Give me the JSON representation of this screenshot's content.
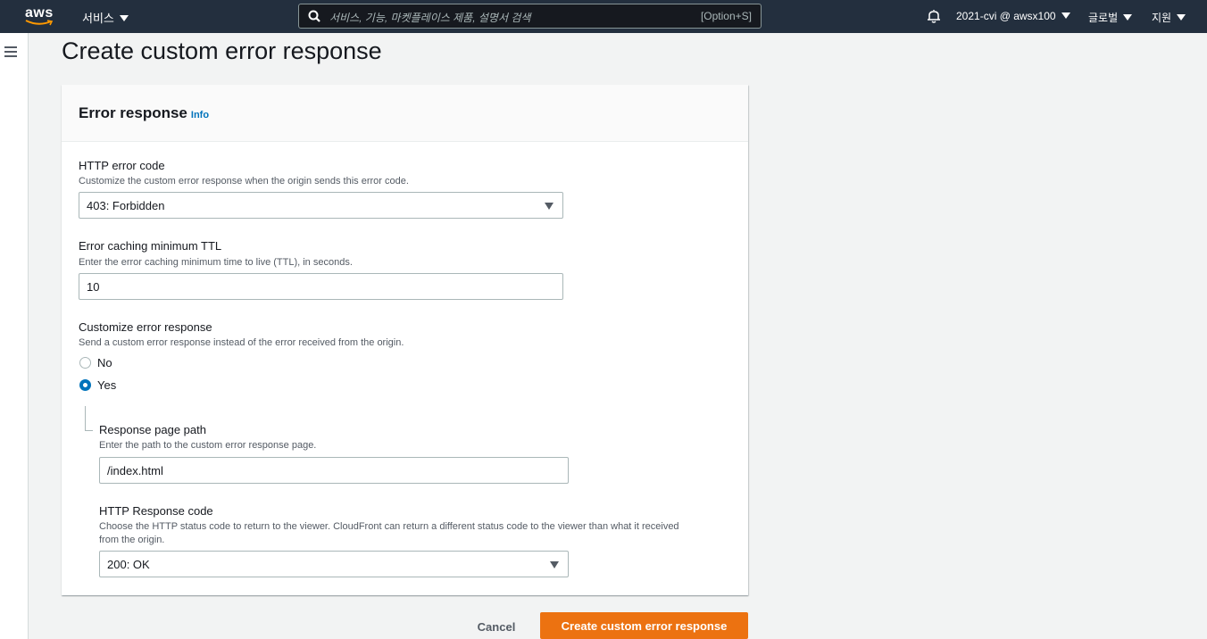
{
  "topnav": {
    "logo_text": "aws",
    "services_label": "서비스",
    "search_placeholder": "서비스, 기능, 마켓플레이스 제품, 설명서 검색",
    "search_shortcut": "[Option+S]",
    "account_label": "2021-cvi @ awsx100",
    "region_label": "글로벌",
    "support_label": "지원"
  },
  "page": {
    "title": "Create custom error response"
  },
  "panel": {
    "title": "Error response",
    "info_label": "Info",
    "http_error_code": {
      "label": "HTTP error code",
      "description": "Customize the custom error response when the origin sends this error code.",
      "value": "403: Forbidden"
    },
    "ttl": {
      "label": "Error caching minimum TTL",
      "description": "Enter the error caching minimum time to live (TTL), in seconds.",
      "value": "10"
    },
    "customize": {
      "label": "Customize error response",
      "description": "Send a custom error response instead of the error received from the origin.",
      "options": [
        "No",
        "Yes"
      ],
      "selected": "Yes"
    },
    "response_page_path": {
      "label": "Response page path",
      "description": "Enter the path to the custom error response page.",
      "value": "/index.html"
    },
    "http_response_code": {
      "label": "HTTP Response code",
      "description_line1": "Choose the HTTP status code to return to the viewer. CloudFront can return a different status code to the viewer than what it received",
      "description_line2": "from the origin.",
      "value": "200: OK"
    }
  },
  "actions": {
    "cancel_label": "Cancel",
    "submit_label": "Create custom error response"
  },
  "colors": {
    "nav_bg": "#232f3e",
    "primary": "#ec7211",
    "link": "#0073bb"
  }
}
